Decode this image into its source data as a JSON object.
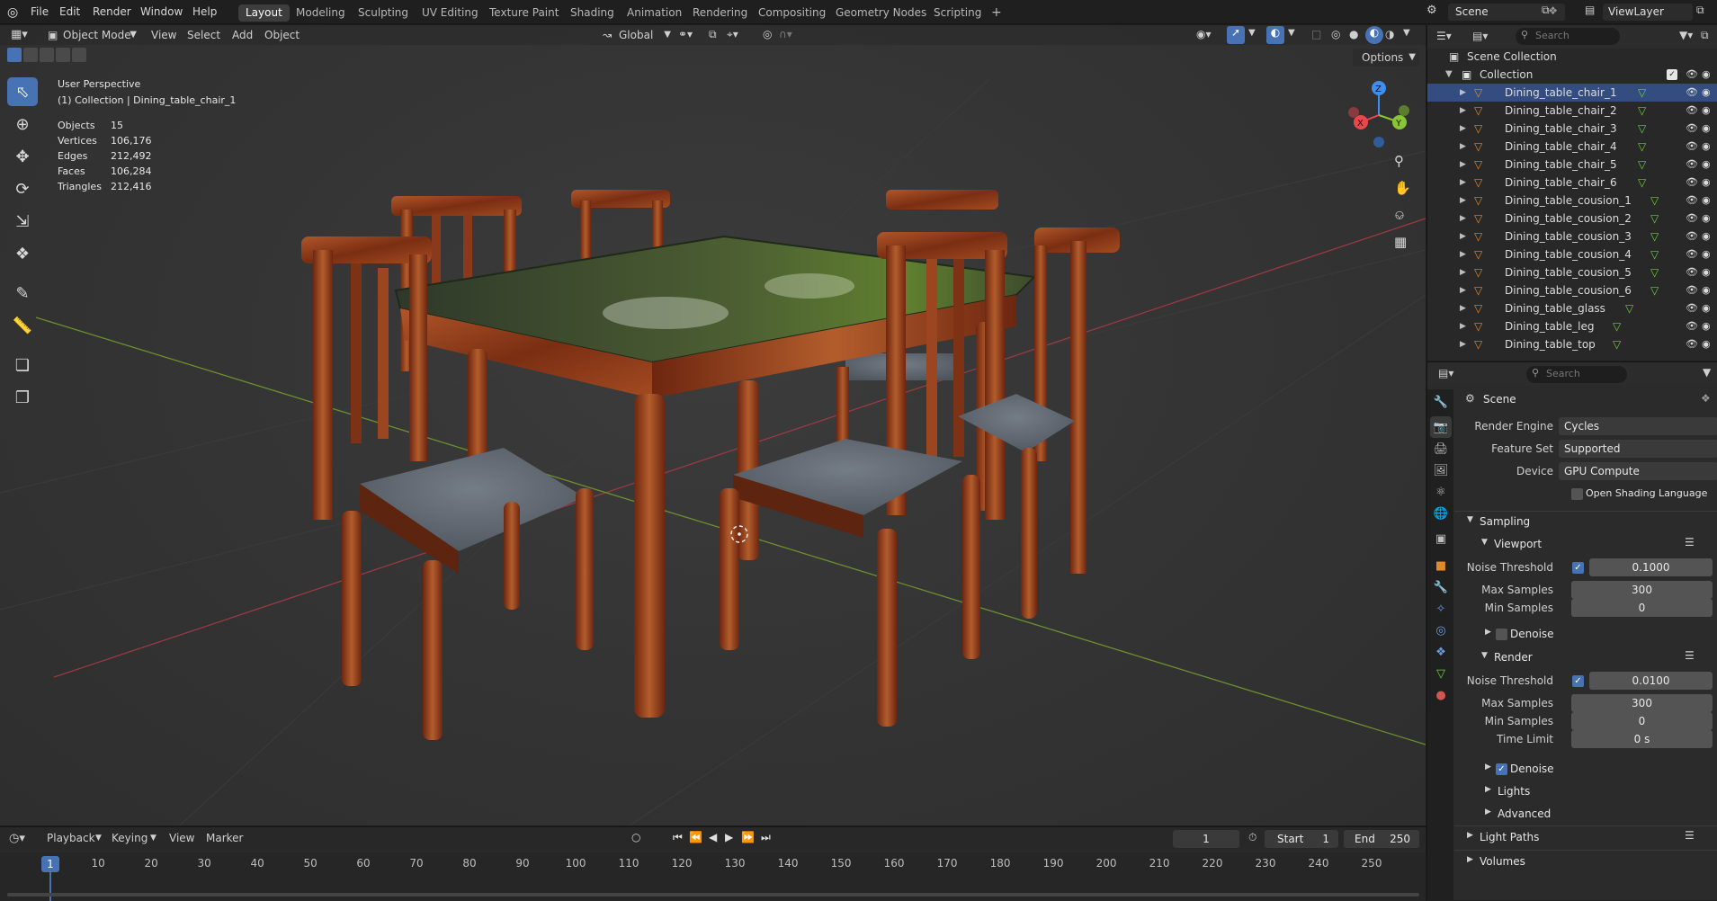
{
  "topbar": {
    "menus": [
      "File",
      "Edit",
      "Render",
      "Window",
      "Help"
    ],
    "workspaces": [
      "Layout",
      "Modeling",
      "Sculpting",
      "UV Editing",
      "Texture Paint",
      "Shading",
      "Animation",
      "Rendering",
      "Compositing",
      "Geometry Nodes",
      "Scripting"
    ],
    "active_workspace": "Layout",
    "add_tab": "+",
    "scene_name": "Scene",
    "view_layer": "ViewLayer"
  },
  "viewport_header": {
    "mode": "Object Mode",
    "menus": [
      "View",
      "Select",
      "Add",
      "Object"
    ],
    "transform_orientation": "Global",
    "options_label": "Options"
  },
  "viewport": {
    "view_name": "User Perspective",
    "context": "(1) Collection | Dining_table_chair_1",
    "stats": [
      {
        "label": "Objects",
        "value": "15"
      },
      {
        "label": "Vertices",
        "value": "106,176"
      },
      {
        "label": "Edges",
        "value": "212,492"
      },
      {
        "label": "Faces",
        "value": "106,284"
      },
      {
        "label": "Triangles",
        "value": "212,416"
      }
    ],
    "gizmo": {
      "x": "X",
      "y": "Y",
      "z": "Z"
    }
  },
  "outliner": {
    "search_placeholder": "Search",
    "root": "Scene Collection",
    "collection": "Collection",
    "items": [
      "Dining_table_chair_1",
      "Dining_table_chair_2",
      "Dining_table_chair_3",
      "Dining_table_chair_4",
      "Dining_table_chair_5",
      "Dining_table_chair_6",
      "Dining_table_cousion_1",
      "Dining_table_cousion_2",
      "Dining_table_cousion_3",
      "Dining_table_cousion_4",
      "Dining_table_cousion_5",
      "Dining_table_cousion_6",
      "Dining_table_glass",
      "Dining_table_leg",
      "Dining_table_top"
    ]
  },
  "properties": {
    "search_placeholder": "Search",
    "context": "Scene",
    "render_engine_label": "Render Engine",
    "render_engine": "Cycles",
    "feature_set_label": "Feature Set",
    "feature_set": "Supported",
    "device_label": "Device",
    "device": "GPU Compute",
    "osl_label": "Open Shading Language",
    "sampling": "Sampling",
    "viewport": "Viewport",
    "vp_noise_label": "Noise Threshold",
    "vp_noise": "0.1000",
    "vp_max_label": "Max Samples",
    "vp_max": "300",
    "vp_min_label": "Min Samples",
    "vp_min": "0",
    "vp_denoise": "Denoise",
    "render": "Render",
    "r_noise_label": "Noise Threshold",
    "r_noise": "0.0100",
    "r_max_label": "Max Samples",
    "r_max": "300",
    "r_min_label": "Min Samples",
    "r_min": "0",
    "r_time_label": "Time Limit",
    "r_time": "0 s",
    "r_denoise": "Denoise",
    "lights": "Lights",
    "advanced": "Advanced",
    "light_paths": "Light Paths",
    "volumes": "Volumes"
  },
  "timeline": {
    "menus": [
      "Playback",
      "Keying",
      "View",
      "Marker"
    ],
    "current_frame": "1",
    "start_label": "Start",
    "start": "1",
    "end_label": "End",
    "end": "250",
    "ruler": [
      "1",
      "10",
      "20",
      "30",
      "40",
      "50",
      "60",
      "70",
      "80",
      "90",
      "100",
      "110",
      "120",
      "130",
      "140",
      "150",
      "160",
      "170",
      "180",
      "190",
      "200",
      "210",
      "220",
      "230",
      "240",
      "250"
    ]
  },
  "colors": {
    "accent": "#4772b3",
    "x_axis": "#e8474c",
    "y_axis": "#8ac534",
    "z_axis": "#3d8ff0",
    "wood": "#8a3a1a",
    "cushion": "#5f6770"
  }
}
